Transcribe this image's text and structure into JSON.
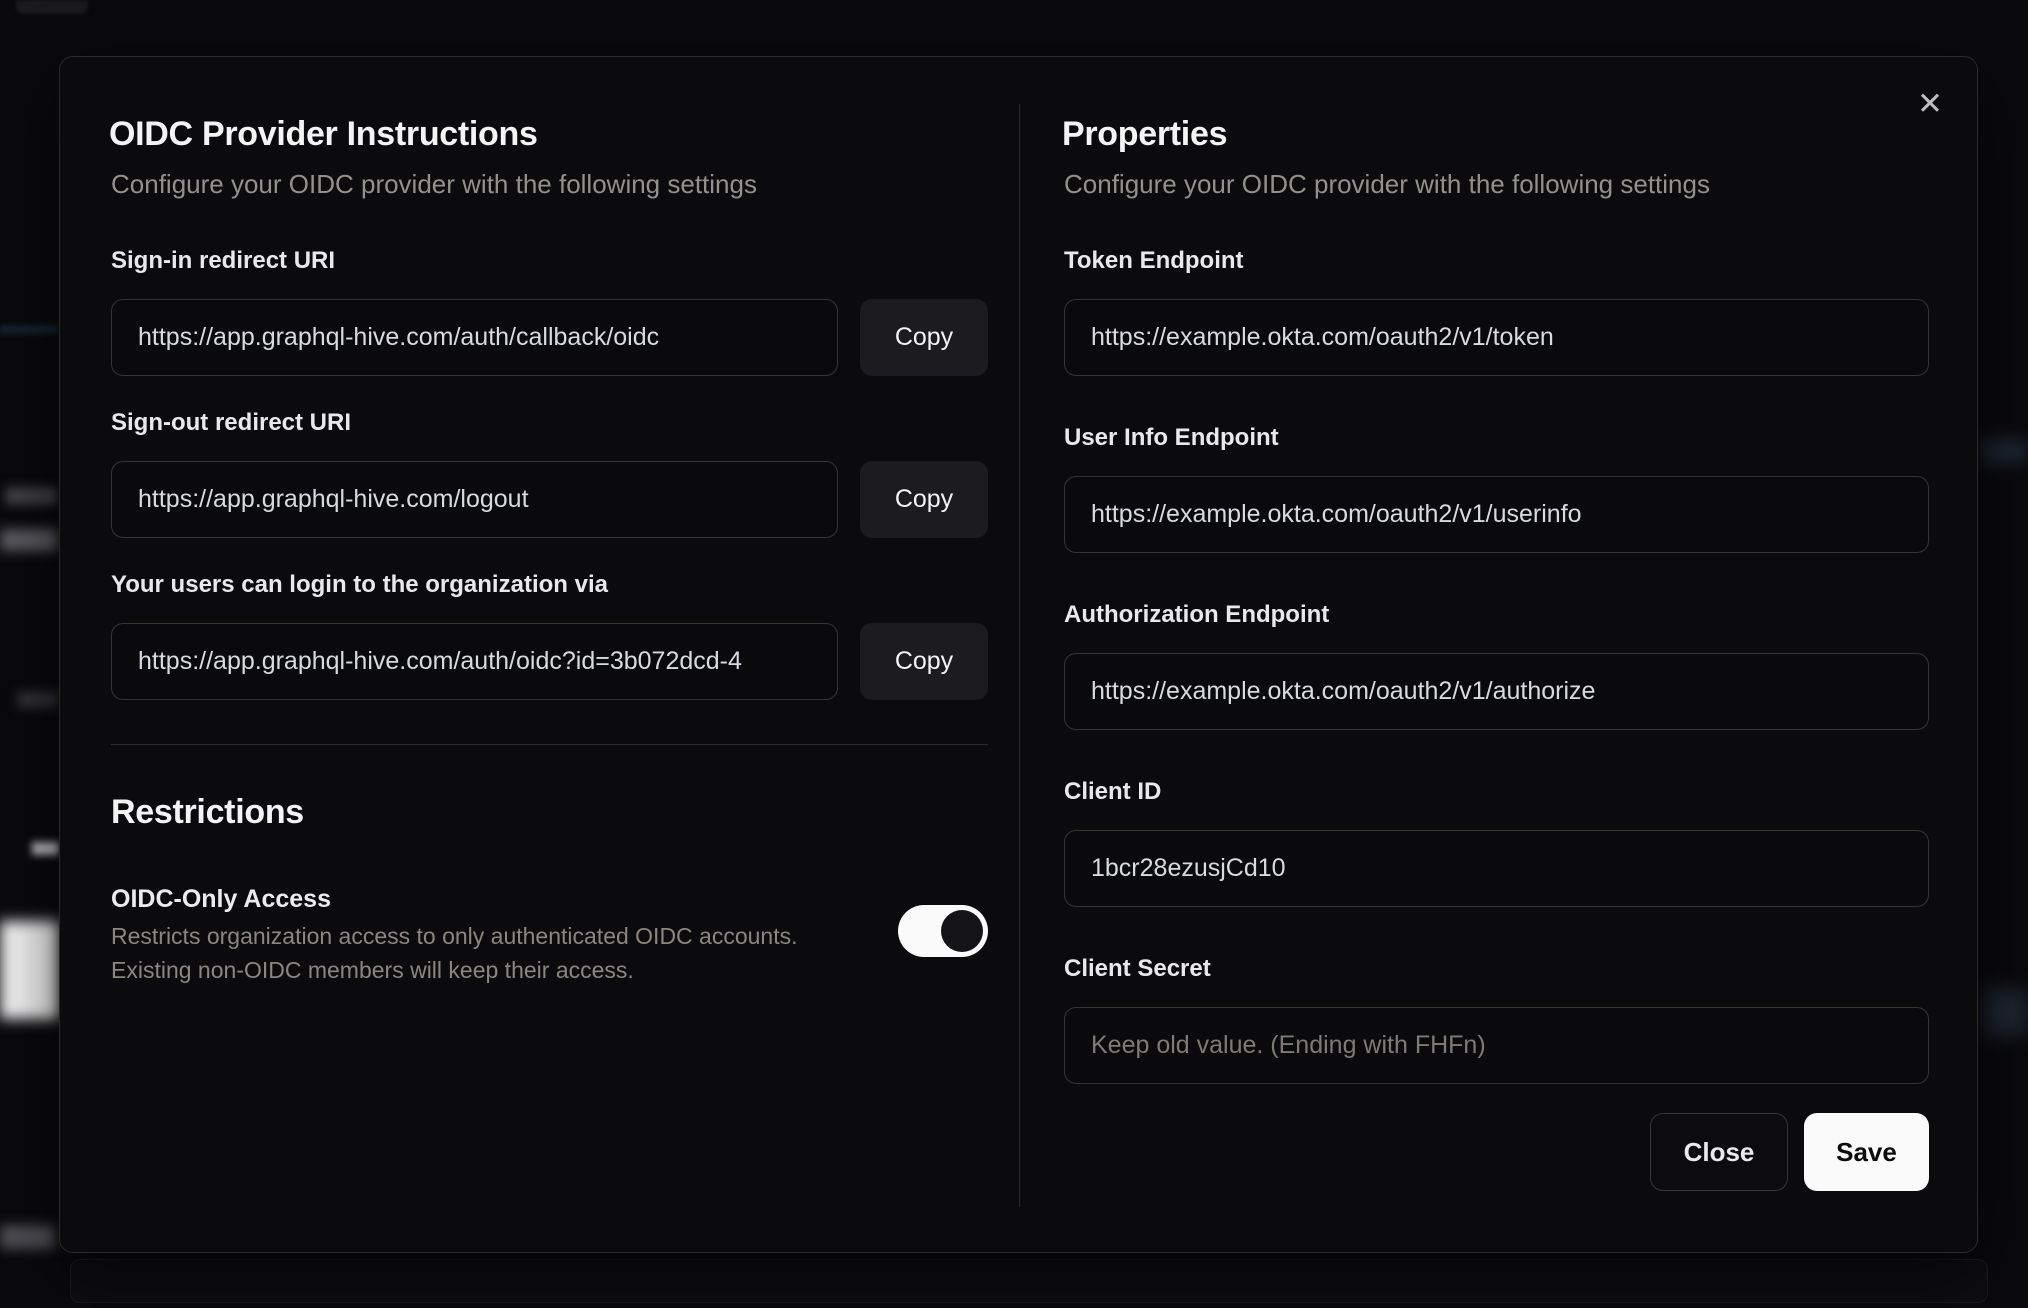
{
  "modal": {
    "left": {
      "title": "OIDC Provider Instructions",
      "subtitle": "Configure your OIDC provider with the following settings",
      "fields": [
        {
          "label": "Sign-in redirect URI",
          "value": "https://app.graphql-hive.com/auth/callback/oidc",
          "copy_label": "Copy"
        },
        {
          "label": "Sign-out redirect URI",
          "value": "https://app.graphql-hive.com/logout",
          "copy_label": "Copy"
        },
        {
          "label": "Your users can login to the organization via",
          "value": "https://app.graphql-hive.com/auth/oidc?id=3b072dcd-4",
          "copy_label": "Copy"
        }
      ],
      "restrictions": {
        "heading": "Restrictions",
        "toggle_label": "OIDC-Only Access",
        "description_line1": "Restricts organization access to only authenticated OIDC accounts.",
        "description_line2": "Existing non-OIDC members will keep their access.",
        "toggle_state": "on"
      }
    },
    "right": {
      "title": "Properties",
      "subtitle": "Configure your OIDC provider with the following settings",
      "fields": [
        {
          "label": "Token Endpoint",
          "value": "https://example.okta.com/oauth2/v1/token"
        },
        {
          "label": "User Info Endpoint",
          "value": "https://example.okta.com/oauth2/v1/userinfo"
        },
        {
          "label": "Authorization Endpoint",
          "value": "https://example.okta.com/oauth2/v1/authorize"
        },
        {
          "label": "Client ID",
          "value": "1bcr28ezusjCd10"
        },
        {
          "label": "Client Secret",
          "value": "",
          "placeholder": "Keep old value. (Ending with FHFn)"
        }
      ],
      "close_icon": "✕",
      "buttons": {
        "close": "Close",
        "save": "Save"
      }
    },
    "colors": {
      "page_bg": "#0a0a0d",
      "modal_bg": "#0b0b0e",
      "input_border": "#39352e",
      "save_button_bg": "#fafafa",
      "toggle_on_track": "#fafafa",
      "toggle_knob": "#131318"
    }
  }
}
